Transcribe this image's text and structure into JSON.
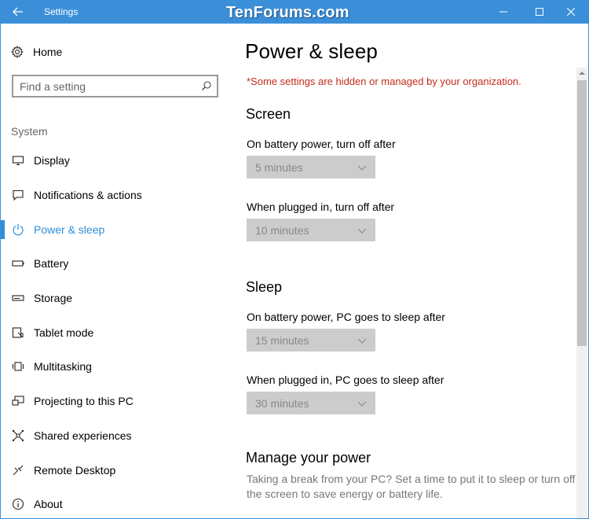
{
  "window": {
    "title": "Settings",
    "watermark": "TenForums.com"
  },
  "sidebar": {
    "home_label": "Home",
    "search_placeholder": "Find a setting",
    "group_label": "System",
    "items": [
      {
        "label": "Display",
        "icon": "monitor-icon"
      },
      {
        "label": "Notifications & actions",
        "icon": "message-icon"
      },
      {
        "label": "Power & sleep",
        "icon": "power-icon",
        "active": true
      },
      {
        "label": "Battery",
        "icon": "battery-icon"
      },
      {
        "label": "Storage",
        "icon": "storage-icon"
      },
      {
        "label": "Tablet mode",
        "icon": "tablet-icon"
      },
      {
        "label": "Multitasking",
        "icon": "multitasking-icon"
      },
      {
        "label": "Projecting to this PC",
        "icon": "projecting-icon"
      },
      {
        "label": "Shared experiences",
        "icon": "shared-icon"
      },
      {
        "label": "Remote Desktop",
        "icon": "remote-icon"
      },
      {
        "label": "About",
        "icon": "info-icon"
      }
    ]
  },
  "content": {
    "title": "Power & sleep",
    "notice": "*Some settings are hidden or managed by your organization.",
    "screen": {
      "heading": "Screen",
      "battery_label": "On battery power, turn off after",
      "battery_value": "5 minutes",
      "plugged_label": "When plugged in, turn off after",
      "plugged_value": "10 minutes"
    },
    "sleep": {
      "heading": "Sleep",
      "battery_label": "On battery power, PC goes to sleep after",
      "battery_value": "15 minutes",
      "plugged_label": "When plugged in, PC goes to sleep after",
      "plugged_value": "30 minutes"
    },
    "manage": {
      "heading": "Manage your power",
      "description": "Taking a break from your PC? Set a time to put it to sleep or turn off the screen to save energy or battery life."
    }
  },
  "colors": {
    "titlebar": "#3b8fd9",
    "accent": "#2f8fdb",
    "notice": "#c42b1c",
    "dropdown_disabled": "#cccccc"
  }
}
